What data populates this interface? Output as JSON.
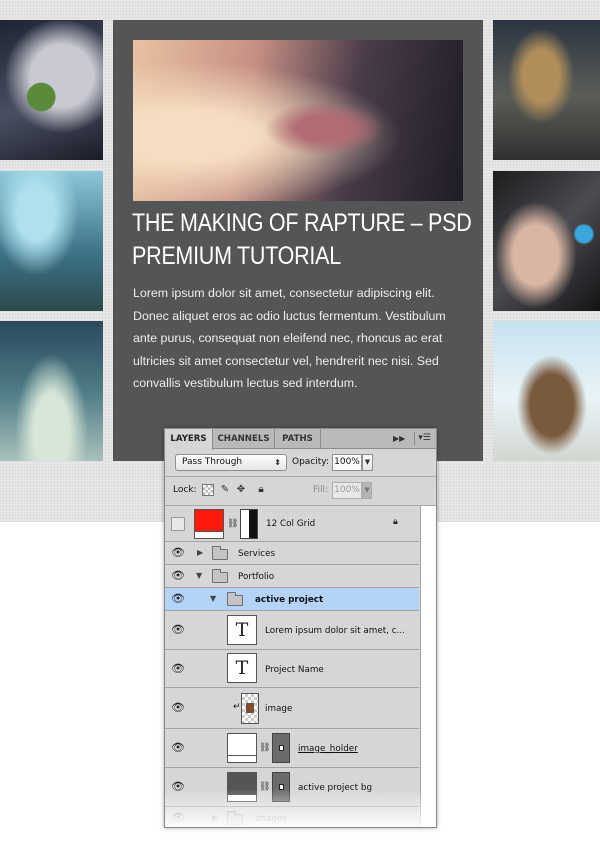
{
  "project": {
    "title": "THE MAKING OF RAPTURE – PSD PREMIUM TUTORIAL",
    "description": "Lorem ipsum dolor sit amet, consectetur adipiscing elit. Donec aliquet eros ac odio luctus fermentum. Vestibulum ante purus, consequat non eleifend nec, rhoncus ac erat ultricies sit amet consectetur vel, hendrerit nec nisi. Sed convallis vestibulum lectus sed interdum."
  },
  "panel": {
    "tabs": {
      "layers": "LAYERS",
      "channels": "CHANNELS",
      "paths": "PATHS"
    },
    "collapse_icon": "double-arrow-icon",
    "menu_icon": "panel-menu-icon",
    "blend_mode": "Pass Through",
    "opacity_label": "Opacity:",
    "opacity_value": "100%",
    "lock_label": "Lock:",
    "fill_label": "Fill:",
    "fill_value": "100%",
    "layers": [
      {
        "name": "12 Col Grid"
      },
      {
        "name": "Services"
      },
      {
        "name": "Portfolio"
      },
      {
        "name": "active project"
      },
      {
        "name": "Lorem ipsum dolor sit amet, c..."
      },
      {
        "name": "Project Name"
      },
      {
        "name": "image"
      },
      {
        "name": "image_holder"
      },
      {
        "name": "active project bg"
      },
      {
        "name": "images"
      }
    ]
  },
  "colors": {
    "active_project_bg": "#545556",
    "grid_swatch": "#ff1a0e",
    "selected_layer": "#b3d3f8"
  }
}
